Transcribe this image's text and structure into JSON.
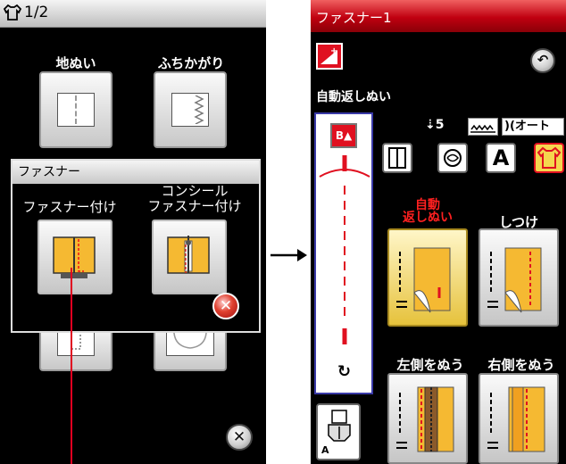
{
  "left_panel": {
    "page_indicator": "1/2",
    "labels": {
      "straight": "地ぬい",
      "overcast": "ふちかがり"
    }
  },
  "dialog": {
    "title": "ファスナー",
    "options": [
      {
        "label": "ファスナー付け"
      },
      {
        "label_line1": "コンシール",
        "label_line2": "ファスナー付け"
      }
    ]
  },
  "right_panel": {
    "title": "ファスナー1",
    "section_label": "自動返しぬい",
    "indicators": {
      "stitch_length": "5",
      "auto_label": "オート"
    },
    "options": [
      {
        "label_line1": "自動",
        "label_line2": "返しぬい"
      },
      {
        "label": "しつけ"
      },
      {
        "label": "左側をぬう"
      },
      {
        "label": "右側をぬう"
      }
    ],
    "presser_foot": "A"
  },
  "colors": {
    "accent_red": "#c00010",
    "highlight_yellow": "#f5d64e",
    "zipper_orange": "#f5b932"
  }
}
